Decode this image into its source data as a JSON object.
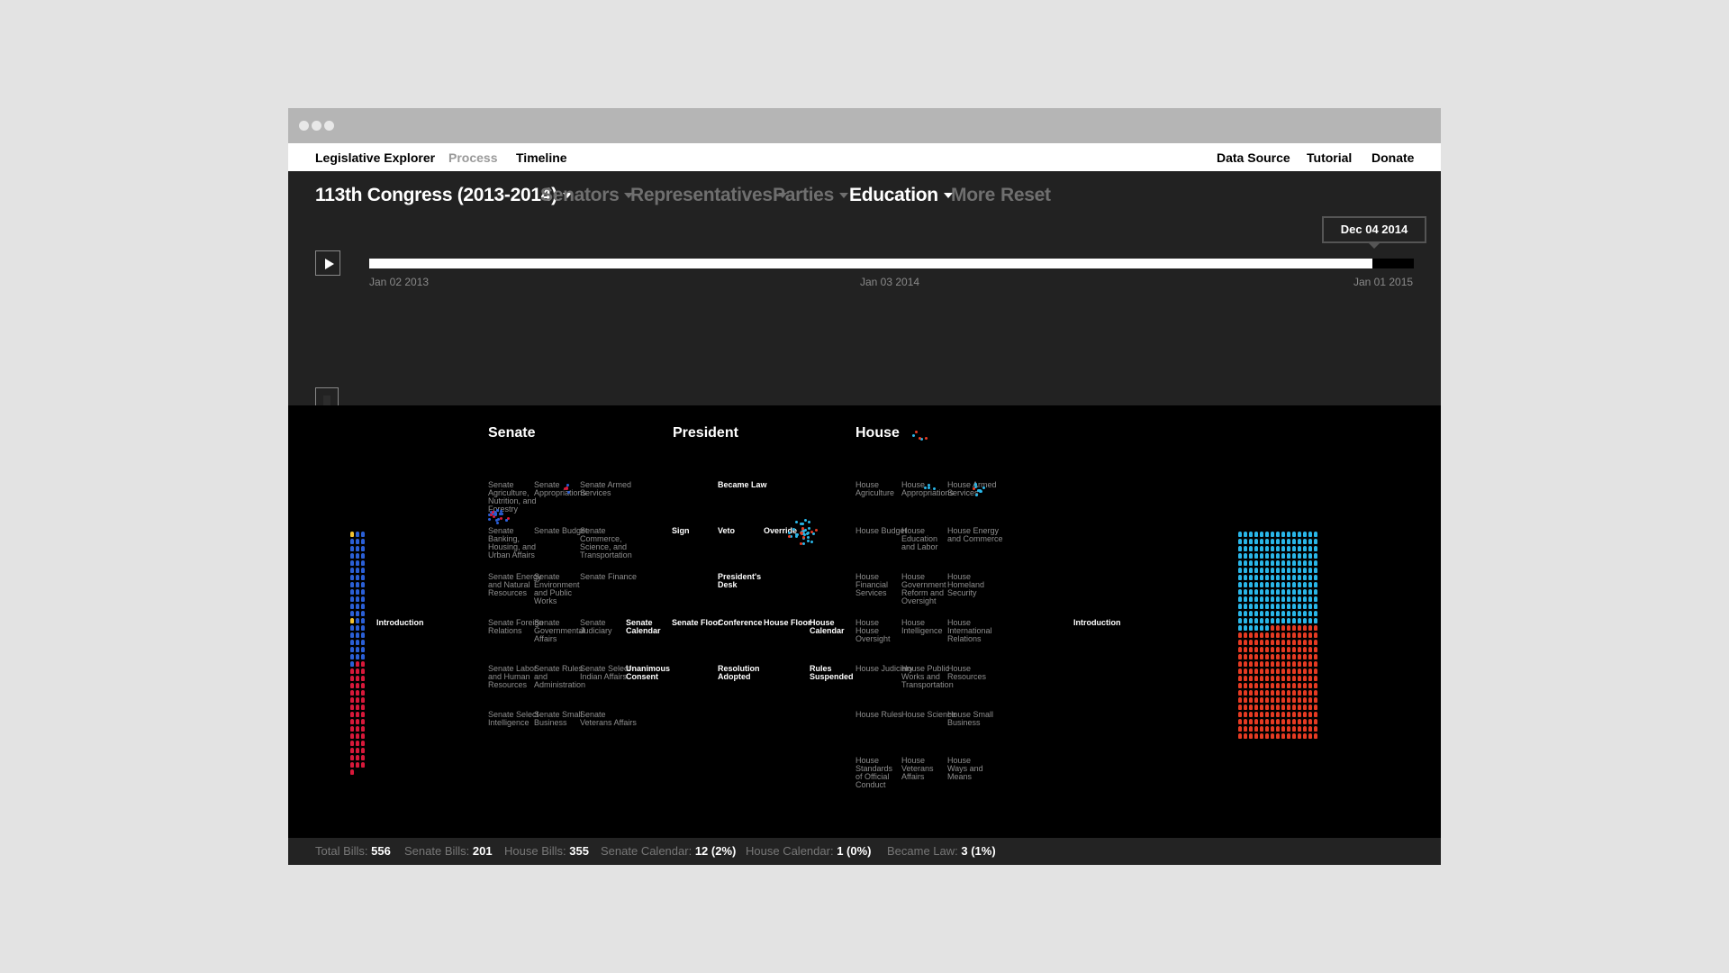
{
  "topnav": {
    "left": [
      {
        "label": "Legislative Explorer",
        "active": true
      },
      {
        "label": "Process",
        "active": false
      },
      {
        "label": "Timeline",
        "active": true
      }
    ],
    "right": [
      "Data Source",
      "Tutorial",
      "Donate"
    ]
  },
  "filters": [
    {
      "label": "113th Congress (2013-2014)",
      "active": true,
      "dropdown": true
    },
    {
      "label": "Senators",
      "active": false,
      "dropdown": true
    },
    {
      "label": "Representatives",
      "active": false,
      "dropdown": true
    },
    {
      "label": "Parties",
      "active": false,
      "dropdown": true
    },
    {
      "label": "Education",
      "active": true,
      "dropdown": true
    },
    {
      "label": "More",
      "active": false,
      "dropdown": false
    },
    {
      "label": "Reset",
      "active": false,
      "dropdown": false
    }
  ],
  "timeline": {
    "current_date": "Dec 04 2014",
    "progress": 0.96,
    "ticks": [
      "Jan 02 2013",
      "Jan 03 2014",
      "Jan 01 2015"
    ]
  },
  "zoom_level": 0.1,
  "sections": {
    "senate": "Senate",
    "president": "President",
    "house": "House"
  },
  "nodes": {
    "senate": [
      [
        "Senate Agriculture, Nutrition, and Forestry",
        "Senate Appropriations",
        "Senate Armed Services"
      ],
      [
        "Senate Banking, Housing, and Urban Affairs",
        "Senate Budget",
        "Senate Commerce, Science, and Transportation"
      ],
      [
        "Senate Energy and Natural Resources",
        "Senate Environment and Public Works",
        "Senate Finance"
      ],
      [
        "Senate Foreign Relations",
        "Senate Governmental Affairs",
        "Senate Judiciary"
      ],
      [
        "Senate Labor and Human Resources",
        "Senate Rules and Administration",
        "Senate Select Indian Affairs"
      ],
      [
        "Senate Select Intelligence",
        "Senate Small Business",
        "Senate Veterans Affairs"
      ]
    ],
    "house": [
      [
        "House Agriculture",
        "House Appropriations",
        "House Armed Services"
      ],
      [
        "House Budget",
        "House Education and Labor",
        "House Energy and Commerce"
      ],
      [
        "House Financial Services",
        "House Government Reform and Oversight",
        "House Homeland Security"
      ],
      [
        "House House Oversight",
        "House Intelligence",
        "House International Relations"
      ],
      [
        "House Judiciary",
        "House Public Works and Transportation",
        "House Resources"
      ],
      [
        "House Rules",
        "House Science",
        "House Small Business"
      ],
      [
        "House Standards of Official Conduct",
        "House Veterans Affairs",
        "House Ways and Means"
      ]
    ],
    "process": {
      "intro_left": "Introduction",
      "intro_right": "Introduction",
      "senate_calendar": "Senate Calendar",
      "unanimous_consent": "Unanimous Consent",
      "became_law": "Became Law",
      "sign": "Sign",
      "veto": "Veto",
      "override": "Override",
      "presidents_desk": "President's Desk",
      "senate_floor": "Senate Floor",
      "conference": "Conference",
      "house_floor": "House Floor",
      "house_calendar": "House Calendar",
      "resolution_adopted": "Resolution Adopted",
      "rules_suspended": "Rules Suspended"
    }
  },
  "members": {
    "senate": {
      "democrat": 55,
      "republican": 45
    },
    "house": {
      "democrat": 201,
      "republican": 234
    }
  },
  "colors": {
    "democrat_senate": "#2a5fd6",
    "republican_senate": "#d8183a",
    "democrat_house": "#29b6e8",
    "republican_house": "#e53a22",
    "highlight": "#f2c230"
  },
  "stats": [
    {
      "label": "Total Bills:",
      "value": "556"
    },
    {
      "label": "Senate Bills:",
      "value": "201"
    },
    {
      "label": "House Bills:",
      "value": "355"
    },
    {
      "label": "Senate Calendar:",
      "value": "12 (2%)"
    },
    {
      "label": "House Calendar:",
      "value": "1 (0%)"
    },
    {
      "label": "Became Law:",
      "value": "3 (1%)"
    }
  ]
}
